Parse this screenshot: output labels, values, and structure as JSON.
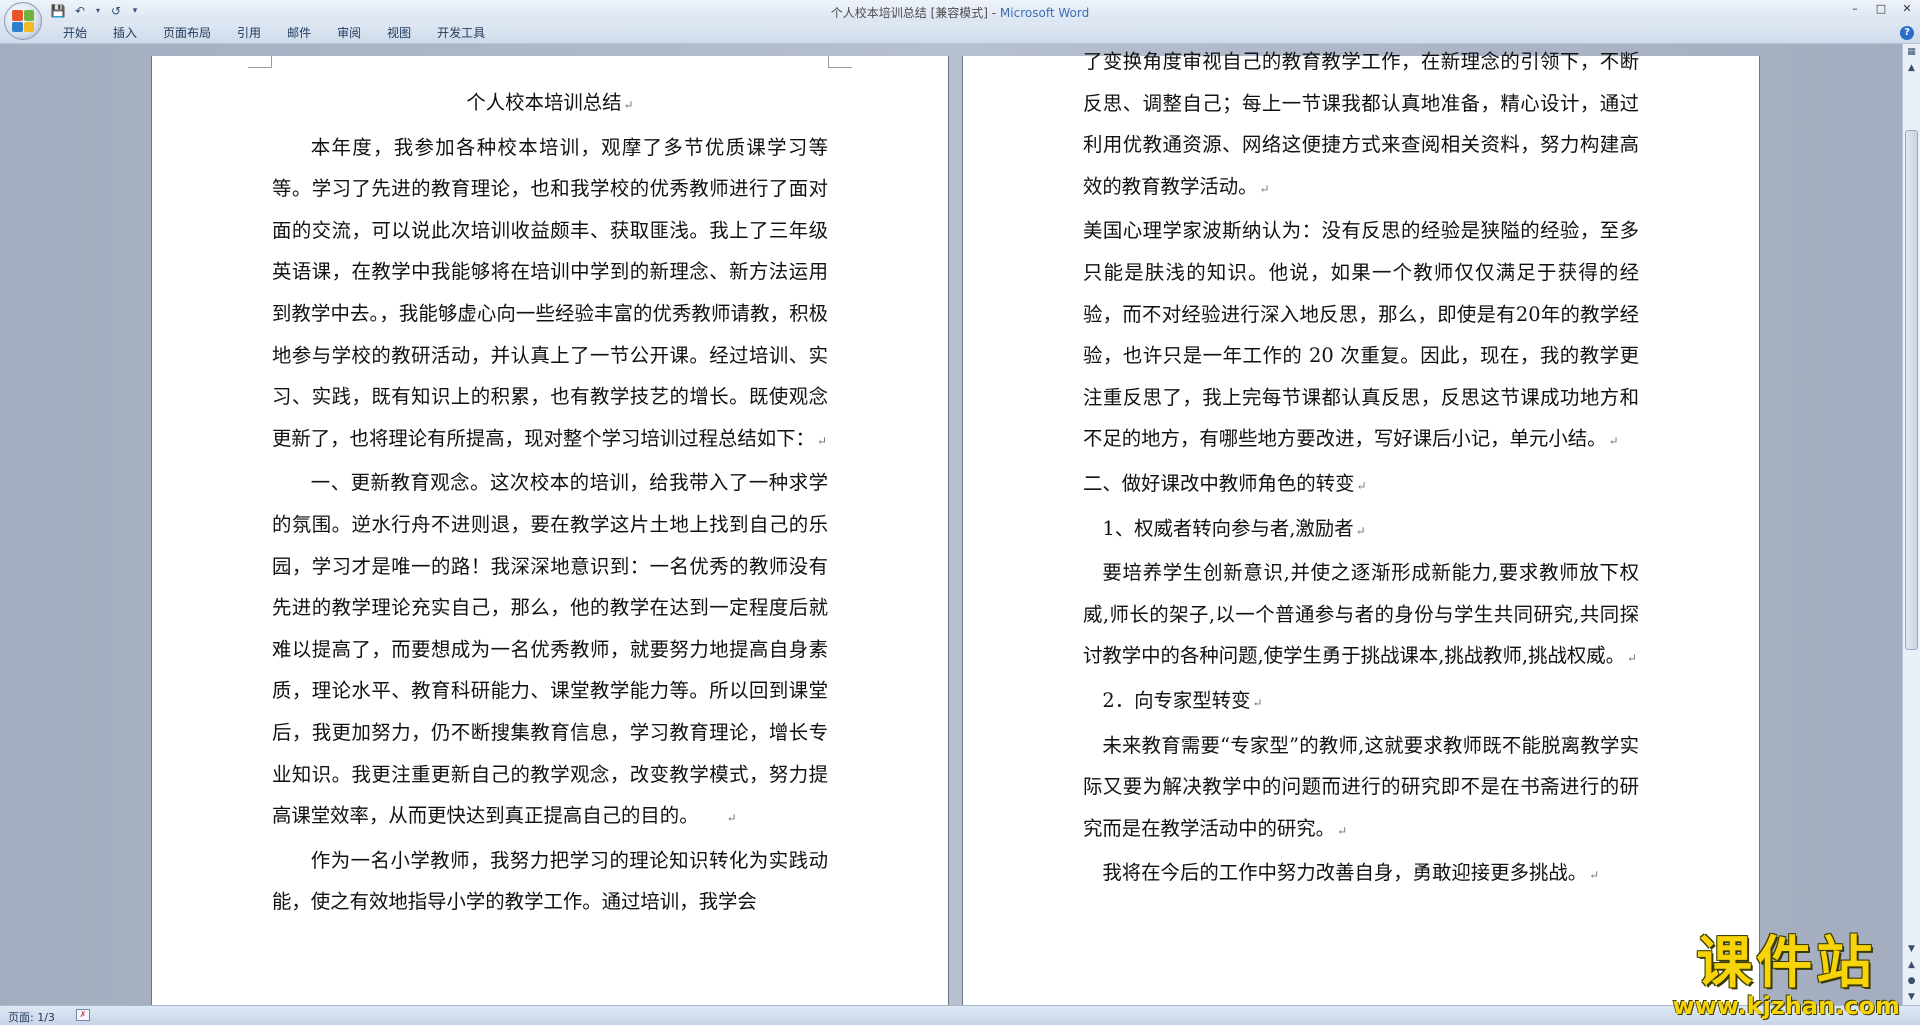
{
  "window": {
    "title_doc": "个人校本培训总结 [兼容模式] - ",
    "title_app": "Microsoft Word"
  },
  "ribbon": {
    "tabs": [
      "开始",
      "插入",
      "页面布局",
      "引用",
      "邮件",
      "审阅",
      "视图",
      "开发工具"
    ],
    "help": "?"
  },
  "page1": {
    "title": "个人校本培训总结",
    "paragraphs": [
      "本年度，我参加各种校本培训，观摩了多节优质课学习等等。学习了先进的教育理论，也和我学校的优秀教师进行了面对面的交流，可以说此次培训收益颇丰、获取匪浅。我上了三年级英语课，在教学中我能够将在培训中学到的新理念、新方法运用到教学中去。，我能够虚心向一些经验丰富的优秀教师请教，积极地参与学校的教研活动，并认真上了一节公开课。经过培训、实习、实践，既有知识上的积累，也有教学技艺的增长。既使观念更新了，也将理论有所提高，现对整个学习培训过程总结如下：",
      "一、更新教育观念。这次校本的培训，给我带入了一种求学的氛围。逆水行舟不进则退，要在教学这片土地上找到自己的乐园，学习才是唯一的路！我深深地意识到：一名优秀的教师没有先进的教学理论充实自己，那么，他的教学在达到一定程度后就难以提高了，而要想成为一名优秀教师，就要努力地提高自身素质，理论水平、教育科研能力、课堂教学能力等。所以回到课堂后，我更加努力，仍不断搜集教育信息，学习教育理论，增长专业知识。我更注重更新自己的教学观念，改变教学模式，努力提高课堂效率，从而更快达到真正提高自己的目的。",
      "作为一名小学教师，我努力把学习的理论知识转化为实践动能，使之有效地指导小学的教学工作。通过培训，我学会"
    ]
  },
  "page2": {
    "paragraphs": [
      "了变换角度审视自己的教育教学工作，在新理念的引领下，不断反思、调整自己；每上一节课我都认真地准备，精心设计，通过利用优教通资源、网络这便捷方式来查阅相关资料，努力构建高效的教育教学活动。",
      "美国心理学家波斯纳认为：没有反思的经验是狭隘的经验，至多只能是肤浅的知识。他说，如果一个教师仅仅满足于获得的经验，而不对经验进行深入地反思，那么，即使是有20年的教学经验，也许只是一年工作的 20 次重复。因此，现在，我的教学更注重反思了，我上完每节课都认真反思，反思这节课成功地方和不足的地方，有哪些地方要改进，写好课后小记，单元小结。",
      "二、做好课改中教师角色的转变",
      "1、权威者转向参与者,激励者",
      "要培养学生创新意识,并使之逐渐形成新能力,要求教师放下权威,师长的架子,以一个普通参与者的身份与学生共同研究,共同探讨教学中的各种问题,使学生勇于挑战课本,挑战教师,挑战权威。",
      "2．向专家型转变",
      "未来教育需要“专家型”的教师,这就要求教师既不能脱离教学实际又要为解决教学中的问题而进行的研究即不是在书斋进行的研究而是在教学活动中的研究。",
      "我将在今后的工作中努力改善自身，勇敢迎接更多挑战。"
    ]
  },
  "status": {
    "page_info": "页面: 1/3"
  },
  "watermark": {
    "cn": "课件站",
    "url": "www.kjzhan.com"
  }
}
